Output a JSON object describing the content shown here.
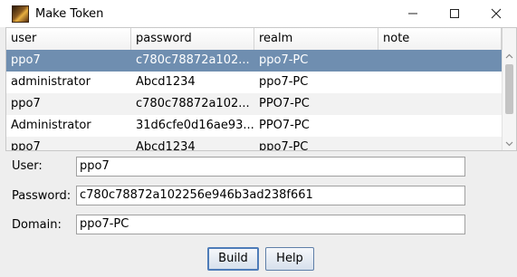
{
  "window": {
    "title": "Make Token"
  },
  "table": {
    "columns": [
      "user",
      "password",
      "realm",
      "note"
    ],
    "rows": [
      {
        "user": "ppo7",
        "password": "c780c78872a102...",
        "realm": "ppo7-PC",
        "note": "",
        "selected": true
      },
      {
        "user": "administrator",
        "password": "Abcd1234",
        "realm": "ppo7-PC",
        "note": ""
      },
      {
        "user": "ppo7",
        "password": "c780c78872a102...",
        "realm": "PPO7-PC",
        "note": ""
      },
      {
        "user": "Administrator",
        "password": "31d6cfe0d16ae93...",
        "realm": "PPO7-PC",
        "note": ""
      },
      {
        "user": "ppo7",
        "password": "Abcd1234",
        "realm": "ppo7-PC",
        "note": ""
      }
    ]
  },
  "form": {
    "user_label": "User:",
    "user_value": "ppo7",
    "password_label": "Password:",
    "password_value": "c780c78872a102256e946b3ad238f661",
    "domain_label": "Domain:",
    "domain_value": "ppo7-PC"
  },
  "buttons": {
    "build": "Build",
    "help": "Help"
  },
  "colors": {
    "selected_row": "#6f8eb0",
    "button_border": "#5f7fa8"
  }
}
